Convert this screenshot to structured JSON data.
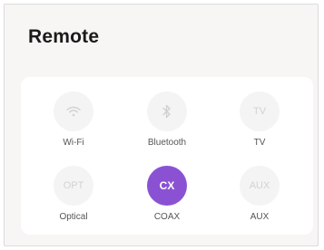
{
  "panel": {
    "title": "Remote"
  },
  "sources": [
    {
      "label": "Wi-Fi",
      "icon": "wifi-icon",
      "glyph": "",
      "active": false
    },
    {
      "label": "Bluetooth",
      "icon": "bluetooth-icon",
      "glyph": "",
      "active": false
    },
    {
      "label": "TV",
      "icon": "tv-icon",
      "glyph": "TV",
      "active": false
    },
    {
      "label": "Optical",
      "icon": "optical-icon",
      "glyph": "OPT",
      "active": false
    },
    {
      "label": "COAX",
      "icon": "coax-icon",
      "glyph": "CX",
      "active": true
    },
    {
      "label": "AUX",
      "icon": "aux-icon",
      "glyph": "AUX",
      "active": false
    }
  ],
  "colors": {
    "accent": "#8a52d3",
    "inactive_circle": "#f4f4f4",
    "inactive_glyph": "#d2d2d2",
    "background": "#f7f6f4"
  }
}
